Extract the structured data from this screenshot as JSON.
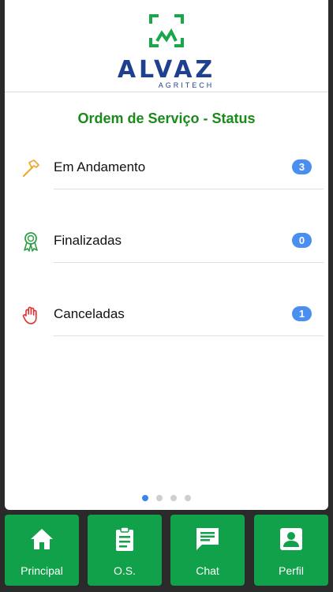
{
  "app": {
    "logo_name": "ALVAZ",
    "logo_tagline": "AGRITECH"
  },
  "page": {
    "title": "Ordem de Serviço - Status"
  },
  "status_items": [
    {
      "label": "Em Andamento",
      "count": "3",
      "icon": "hammer-icon",
      "icon_color": "#f0a830"
    },
    {
      "label": "Finalizadas",
      "count": "0",
      "icon": "award-ribbon-icon",
      "icon_color": "#2f9e44"
    },
    {
      "label": "Canceladas",
      "count": "1",
      "icon": "stop-hand-icon",
      "icon_color": "#e03131"
    }
  ],
  "pager": {
    "pages": 4,
    "active": 1
  },
  "tabs": [
    {
      "label": "Principal",
      "icon": "home-icon"
    },
    {
      "label": "O.S.",
      "icon": "clipboard-icon"
    },
    {
      "label": "Chat",
      "icon": "chat-icon"
    },
    {
      "label": "Perfil",
      "icon": "profile-icon"
    }
  ],
  "colors": {
    "brand_green": "#11a14a",
    "title_green": "#1a8a1a",
    "brand_blue": "#1f3f8f",
    "badge_blue": "#4a8ef0"
  }
}
